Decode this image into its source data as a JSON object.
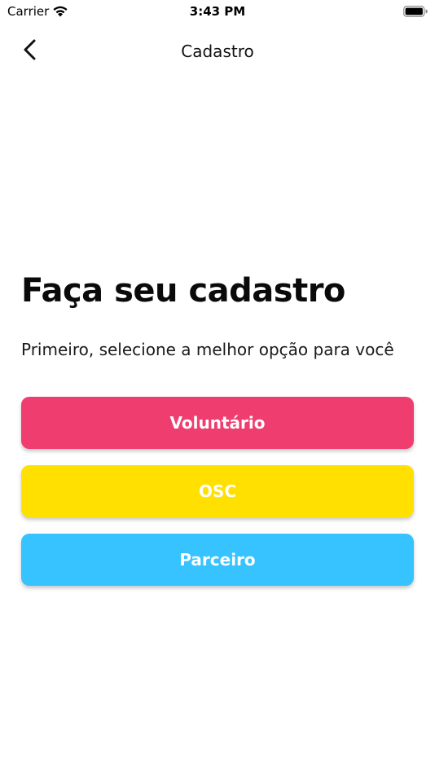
{
  "status_bar": {
    "carrier": "Carrier",
    "time": "3:43 PM"
  },
  "nav": {
    "title": "Cadastro"
  },
  "content": {
    "title": "Faça seu cadastro",
    "subtitle": "Primeiro, selecione a melhor opção para você"
  },
  "options": [
    {
      "label": "Voluntário",
      "color": "#f03d70"
    },
    {
      "label": "OSC",
      "color": "#ffe000"
    },
    {
      "label": "Parceiro",
      "color": "#36c3ff"
    }
  ],
  "icons": {
    "back": "chevron-left-icon",
    "wifi": "wifi-icon",
    "battery": "battery-icon"
  }
}
